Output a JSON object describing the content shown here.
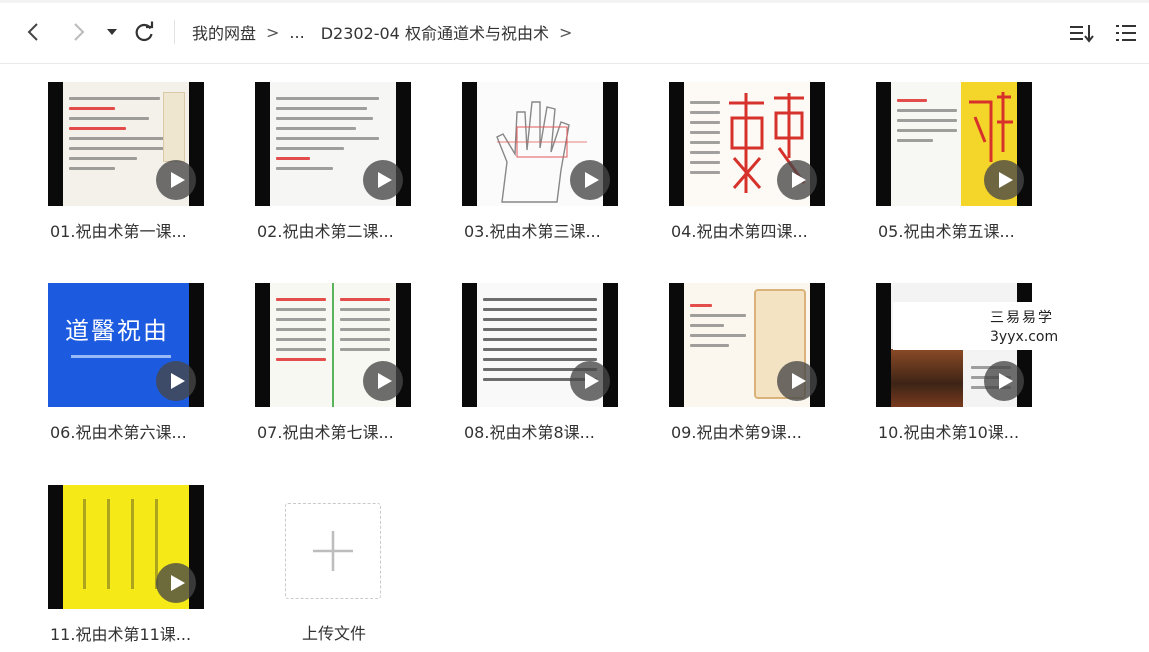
{
  "toolbar": {
    "back_icon": "chevron-left-icon",
    "forward_icon": "chevron-right-icon",
    "dropdown_icon": "caret-down-icon",
    "refresh_icon": "refresh-icon",
    "breadcrumb": {
      "root": "我的网盘",
      "ellipsis": "...",
      "folder": "D2302-04 权俞通道术与祝由术",
      "separator": ">"
    },
    "sort_icon": "sort-icon",
    "list_view_icon": "list-view-icon"
  },
  "files": [
    {
      "name": "01.祝由术第一课...",
      "thumb_style": "text-slide"
    },
    {
      "name": "02.祝由术第二课...",
      "thumb_style": "text-slide"
    },
    {
      "name": "03.祝由术第三课...",
      "thumb_style": "hand"
    },
    {
      "name": "04.祝由术第四课...",
      "thumb_style": "talisman"
    },
    {
      "name": "05.祝由术第五课...",
      "thumb_style": "talisman-yellow"
    },
    {
      "name": "06.祝由术第六课...",
      "thumb_style": "blue-title"
    },
    {
      "name": "07.祝由术第七课...",
      "thumb_style": "text-slide"
    },
    {
      "name": "08.祝由术第8课...",
      "thumb_style": "dense-text"
    },
    {
      "name": "09.祝由术第9课...",
      "thumb_style": "scroll"
    },
    {
      "name": "10.祝由术第10课...",
      "thumb_style": "photo"
    },
    {
      "name": "11.祝由术第11课...",
      "thumb_style": "yellow"
    }
  ],
  "upload": {
    "label": "上传文件",
    "icon": "plus-icon"
  },
  "watermark_overlay": {
    "line1": "三易易学",
    "line2": "3yyx.com"
  },
  "thumb_text": {
    "blue_title": "道醫祝由"
  },
  "colors": {
    "play_bg": "#464646",
    "blue_slide": "#1c5be0",
    "yellow_slide": "#f5ea17",
    "talisman_red": "#d6322b"
  }
}
